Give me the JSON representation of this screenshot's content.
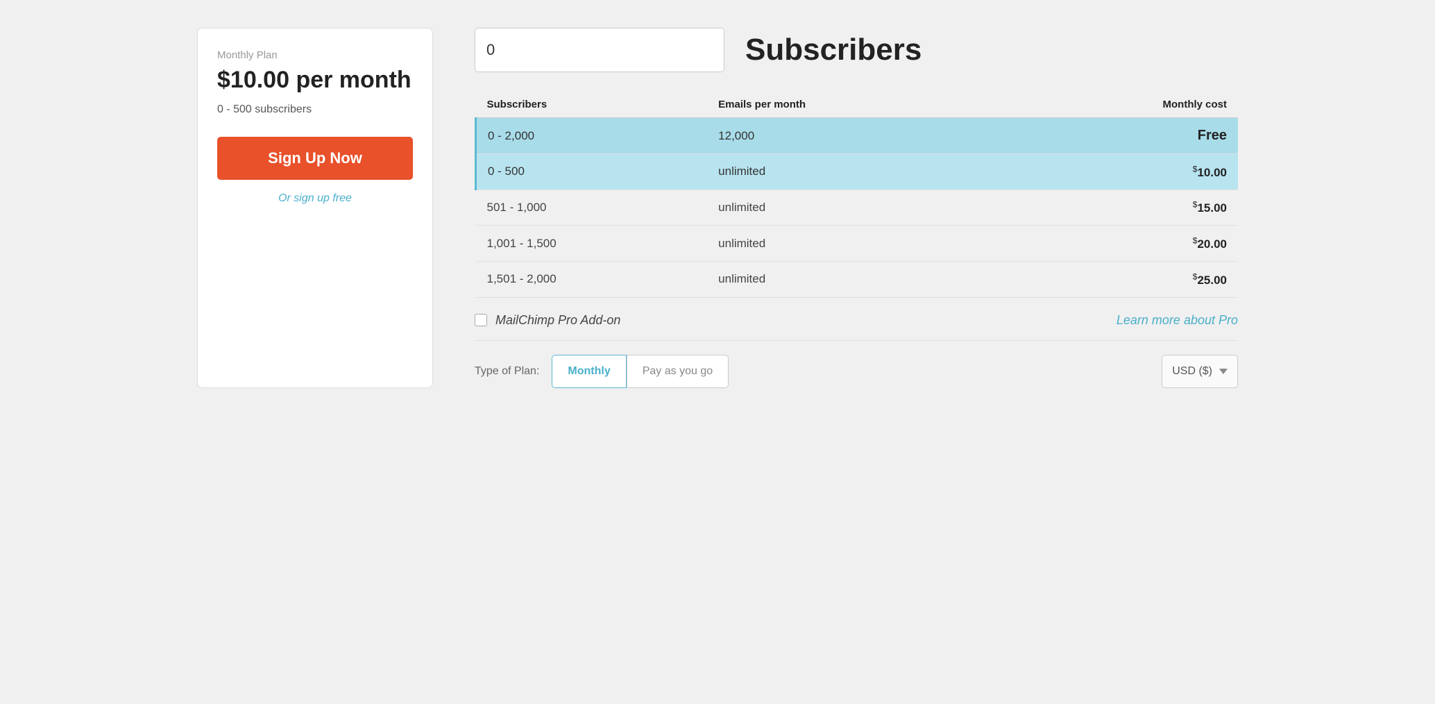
{
  "plan_card": {
    "label": "Monthly Plan",
    "price": "$10.00 per month",
    "subscribers_range": "0 - 500 subscribers",
    "signup_btn": "Sign Up Now",
    "signup_free": "Or sign up free"
  },
  "right_panel": {
    "subscribers_input_value": "0",
    "subscribers_input_placeholder": "0",
    "subscribers_title": "Subscribers",
    "table": {
      "headers": [
        "Subscribers",
        "Emails per month",
        "Monthly cost"
      ],
      "rows": [
        {
          "subscribers": "0 - 2,000",
          "emails": "12,000",
          "cost": "Free",
          "cost_type": "free",
          "highlighted": true
        },
        {
          "subscribers": "0 - 500",
          "emails": "unlimited",
          "cost": "$10.00",
          "cost_prefix": "$",
          "cost_main": "10.00",
          "cost_type": "dollar",
          "highlighted": true
        },
        {
          "subscribers": "501 - 1,000",
          "emails": "unlimited",
          "cost": "$15.00",
          "cost_prefix": "$",
          "cost_main": "15.00",
          "cost_type": "dollar",
          "highlighted": false
        },
        {
          "subscribers": "1,001 - 1,500",
          "emails": "unlimited",
          "cost": "$20.00",
          "cost_prefix": "$",
          "cost_main": "20.00",
          "cost_type": "dollar",
          "highlighted": false
        },
        {
          "subscribers": "1,501 - 2,000",
          "emails": "unlimited",
          "cost": "$25.00",
          "cost_prefix": "$",
          "cost_main": "25.00",
          "cost_type": "dollar",
          "highlighted": false
        }
      ]
    },
    "pro_addon": {
      "label": "MailChimp Pro Add-on",
      "learn_more": "Learn more about Pro"
    },
    "plan_type": {
      "label": "Type of Plan:",
      "monthly": "Monthly",
      "pay_as_you_go": "Pay as you go"
    },
    "currency": {
      "label": "USD ($)"
    }
  }
}
